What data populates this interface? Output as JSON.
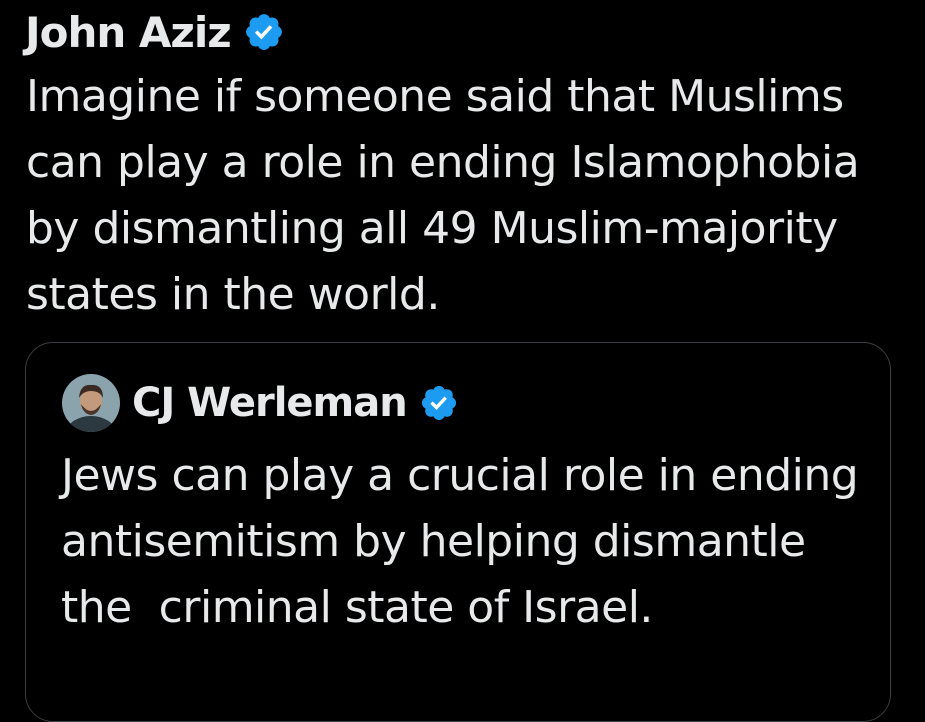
{
  "colors": {
    "background": "#000000",
    "text": "#e7e9ea",
    "verified_badge": "#1d9bf0",
    "card_border": "#3a3d41"
  },
  "post": {
    "author": "John Aziz",
    "verified_icon": "verified-badge-icon",
    "text": "Imagine if someone said that Muslims can play a role in ending Islamophobia by dismantling all 49 Muslim-majority states in the world."
  },
  "quoted_post": {
    "avatar_icon": "avatar",
    "author": "CJ Werleman",
    "verified_icon": "verified-badge-icon",
    "text": "Jews can play a crucial role in ending antisemitism by helping dismantle the  criminal state of Israel."
  }
}
